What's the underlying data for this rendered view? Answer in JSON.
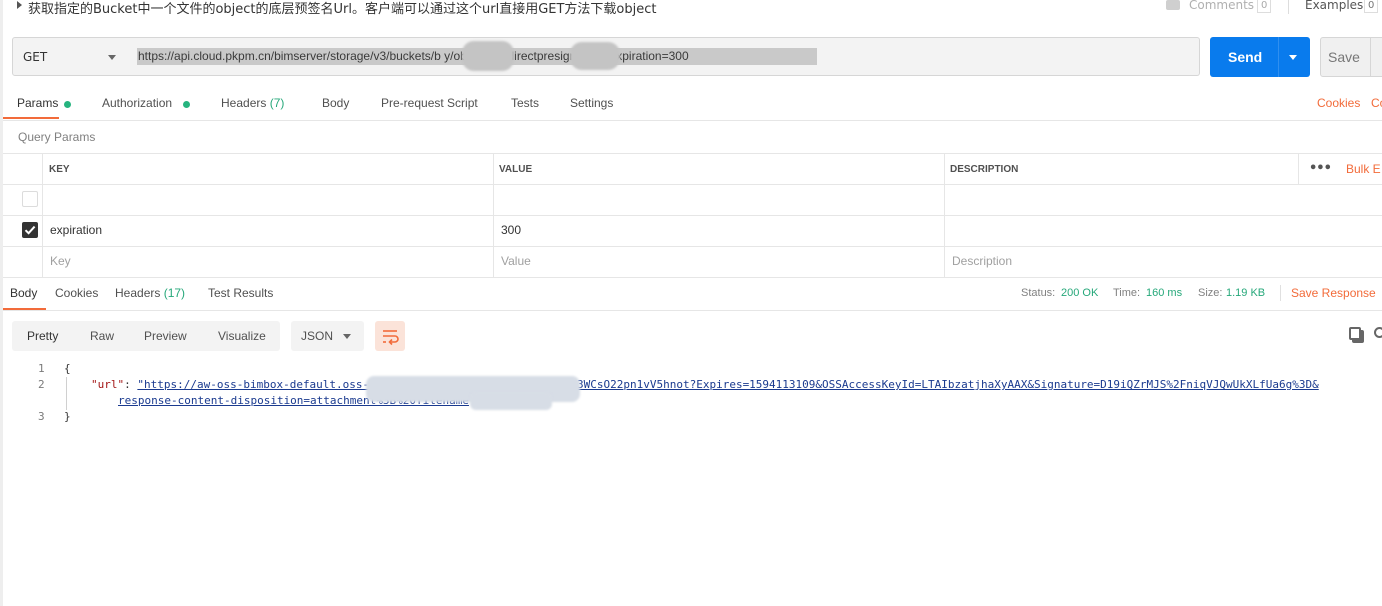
{
  "header": {
    "title": "获取指定的Bucket中一个文件的object的底层预签名Url。客户端可以通过这个url直接用GET方法下载object",
    "comments_label": "Comments",
    "comments_count": "0",
    "examples_label": "Examples",
    "examples_count": "0"
  },
  "request": {
    "method": "GET",
    "url": "https://api.cloud.pkpm.cn/bimserver/storage/v3/buckets/b          y/objects/c          /directpresignedurl?expiration=300",
    "send_label": "Send",
    "save_label": "Save"
  },
  "request_tabs": {
    "params": "Params",
    "authorization": "Authorization",
    "headers": "Headers",
    "headers_count": "(7)",
    "body": "Body",
    "prerequest": "Pre-request Script",
    "tests": "Tests",
    "settings": "Settings",
    "cookies": "Cookies",
    "code": "Co"
  },
  "query_params": {
    "label": "Query Params",
    "columns": {
      "key": "KEY",
      "value": "VALUE",
      "description": "DESCRIPTION"
    },
    "bulk_edit": "Bulk E",
    "rows": [
      {
        "checked": true,
        "key": "expiration",
        "value": "300"
      }
    ],
    "placeholder": {
      "key": "Key",
      "value": "Value",
      "description": "Description"
    }
  },
  "response_tabs": {
    "body": "Body",
    "cookies": "Cookies",
    "headers": "Headers",
    "headers_count": "(17)",
    "test_results": "Test Results"
  },
  "response_meta": {
    "status_label": "Status:",
    "status_value": "200 OK",
    "time_label": "Time:",
    "time_value": "160 ms",
    "size_label": "Size:",
    "size_value": "1.19 KB",
    "save_response": "Save Response"
  },
  "response_view": {
    "pretty": "Pretty",
    "raw": "Raw",
    "preview": "Preview",
    "visualize": "Visualize",
    "format": "JSON"
  },
  "code": {
    "line_numbers": [
      "1",
      "2",
      "3"
    ],
    "open_brace": "{",
    "key": "\"url\"",
    "colon": ": ",
    "url_part1": "\"https://aw-oss-bimbox-default.oss-",
    "url_part2": "3WCsO22pn1vV5hnot?Expires=1594113109&OSSAccessKeyId=LTAIbzatjhaXyAAX&Signature=D19iQZrMJS%2FniqVJQwUkXLfUa6g%3D&",
    "url_part3": "response-content-disposition=attachment%3B%20filename",
    "close_brace": "}"
  },
  "colors": {
    "accent": "#f26b3a",
    "send": "#097bed",
    "status_ok": "#26a87a"
  }
}
